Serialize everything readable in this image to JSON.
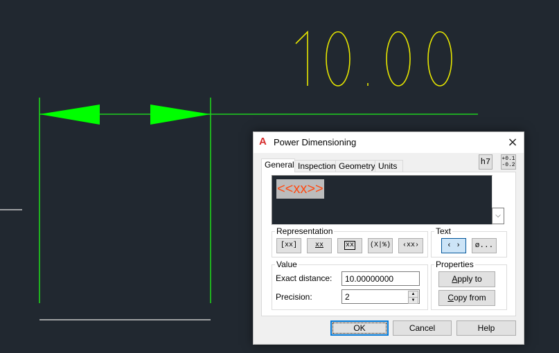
{
  "drawing": {
    "dimension_text": "10.00",
    "colors": {
      "background": "#212830",
      "dimension_text": "#e6e600",
      "dimension_lines": "#00ff00",
      "geometry": "#c8c8c8"
    }
  },
  "dialog": {
    "title": "Power Dimensioning",
    "app_icon": "autocad-logo-icon",
    "close_label": "×",
    "toolbar": {
      "fit_label": "h7",
      "tolerance_upper": "+0.1",
      "tolerance_lower": "-0.2"
    },
    "tabs": [
      {
        "label": "General",
        "active": true
      },
      {
        "label": "Inspection",
        "active": false
      },
      {
        "label": "Geometry",
        "active": false
      },
      {
        "label": "Units",
        "active": false
      }
    ],
    "text_editor": {
      "content": "<<xx>>",
      "text_color": "#ff4a12"
    },
    "representation": {
      "label": "Representation",
      "buttons": [
        "[xx]",
        "xx",
        "xx",
        "(X|%)",
        "‹xx›"
      ]
    },
    "text_group": {
      "label": "Text",
      "buttons": [
        "‹ ›",
        "ø..."
      ]
    },
    "value": {
      "label": "Value",
      "exact_distance_label": "Exact distance:",
      "exact_distance": "10.00000000",
      "precision_label": "Precision:",
      "precision": "2"
    },
    "properties": {
      "label": "Properties",
      "apply_to": {
        "mnemonic": "A",
        "rest": "pply to"
      },
      "copy_from": {
        "mnemonic": "C",
        "rest": "opy from"
      }
    },
    "buttons": {
      "ok": "OK",
      "cancel": "Cancel",
      "help": "Help"
    }
  }
}
